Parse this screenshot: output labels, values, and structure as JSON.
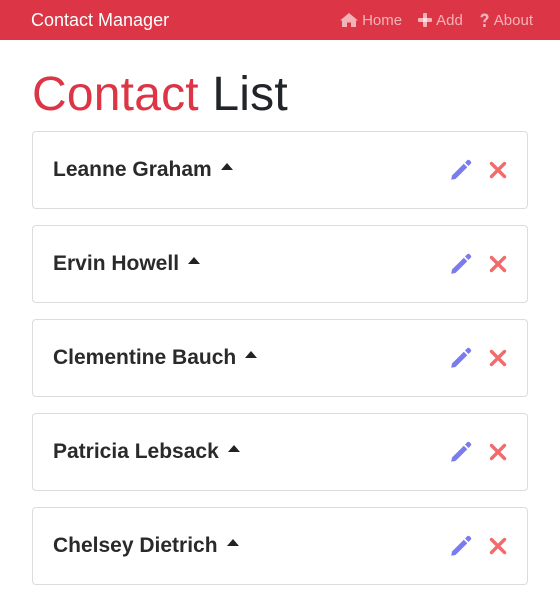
{
  "navbar": {
    "brand": "Contact Manager",
    "links": [
      {
        "label": "Home",
        "icon": "home-icon"
      },
      {
        "label": "Add",
        "icon": "plus-icon"
      },
      {
        "label": "About",
        "icon": "question-icon"
      }
    ]
  },
  "page_title": {
    "accent": "Contact",
    "rest": "List"
  },
  "contacts": [
    {
      "name": "Leanne Graham"
    },
    {
      "name": "Ervin Howell"
    },
    {
      "name": "Clementine Bauch"
    },
    {
      "name": "Patricia Lebsack"
    },
    {
      "name": "Chelsey Dietrich"
    }
  ],
  "icons": {
    "toggle": "caret-up-icon",
    "edit": "pencil-icon",
    "delete": "times-icon"
  },
  "colors": {
    "navbar": "#dc3545",
    "title_accent": "#dc3545",
    "edit_icon": "#7b7bf0",
    "delete_icon": "#f26b6b"
  }
}
